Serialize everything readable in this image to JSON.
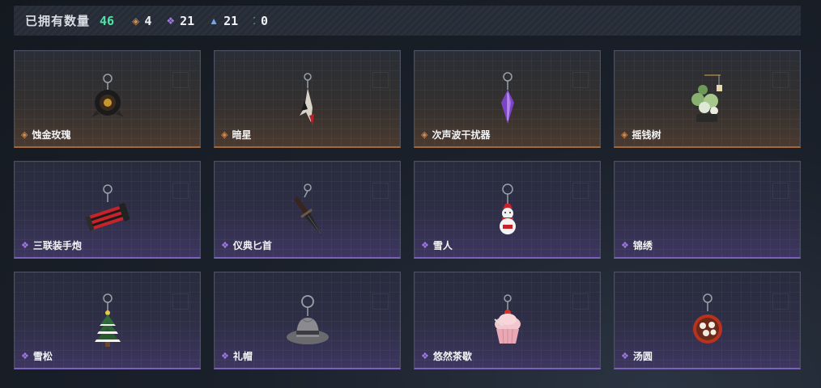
{
  "summary": {
    "owned_label": "已拥有数量",
    "owned_count": "46",
    "stats": [
      {
        "icon": "orange-diamond-icon",
        "value": "4"
      },
      {
        "icon": "purple-diamond-icon",
        "value": "21"
      },
      {
        "icon": "blue-chevron-icon",
        "value": "21"
      },
      {
        "icon": "teal-dots-icon",
        "value": "0"
      }
    ]
  },
  "items": [
    {
      "name": "蚀金玫瑰",
      "rarity": "orange",
      "icon": "rose-charm-icon"
    },
    {
      "name": "暗星",
      "rarity": "orange",
      "icon": "blade-charm-icon"
    },
    {
      "name": "次声波干扰器",
      "rarity": "orange",
      "icon": "crystal-charm-icon"
    },
    {
      "name": "摇钱树",
      "rarity": "orange",
      "icon": "bonsai-charm-icon"
    },
    {
      "name": "三联装手炮",
      "rarity": "purple",
      "icon": "cannon-charm-icon"
    },
    {
      "name": "仪典匕首",
      "rarity": "purple",
      "icon": "dagger-charm-icon"
    },
    {
      "name": "雪人",
      "rarity": "purple",
      "icon": "snowman-charm-icon"
    },
    {
      "name": "锦绣",
      "rarity": "purple",
      "icon": ""
    },
    {
      "name": "雪松",
      "rarity": "purple",
      "icon": "tree-charm-icon"
    },
    {
      "name": "礼帽",
      "rarity": "purple",
      "icon": "hat-charm-icon"
    },
    {
      "name": "悠然茶歇",
      "rarity": "purple",
      "icon": "cupcake-charm-icon"
    },
    {
      "name": "汤圆",
      "rarity": "purple",
      "icon": "dumpling-charm-icon"
    }
  ],
  "colors": {
    "orange": "#d98a4a",
    "purple": "#a27ae6",
    "owned_count": "#4fe3a8"
  }
}
